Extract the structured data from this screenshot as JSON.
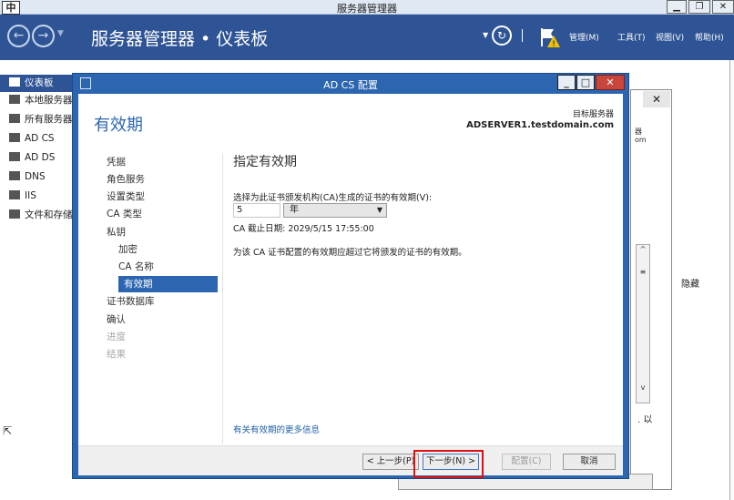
{
  "window": {
    "ime_indicator": "中",
    "title": "服务器管理器"
  },
  "header": {
    "breadcrumb": "服务器管理器 • 仪表板",
    "menus": [
      "管理(M)",
      "工具(T)",
      "视图(V)",
      "帮助(H)"
    ]
  },
  "sidebar": {
    "items": [
      {
        "label": "仪表板",
        "active": true
      },
      {
        "label": "本地服务器"
      },
      {
        "label": "所有服务器"
      },
      {
        "label": "AD CS"
      },
      {
        "label": "AD DS"
      },
      {
        "label": "DNS"
      },
      {
        "label": "IIS"
      },
      {
        "label": "文件和存储服务"
      }
    ]
  },
  "background": {
    "hide_label": "隐藏",
    "cut_text_1": "器",
    "cut_text_2": "om",
    "cut_text_3": ". 以"
  },
  "dialog": {
    "title": "AD CS 配置",
    "page_title": "有效期",
    "target_server_label": "目标服务器",
    "target_server": "ADSERVER1.testdomain.com",
    "nav": [
      {
        "label": "凭据",
        "level": 0,
        "state": "normal"
      },
      {
        "label": "角色服务",
        "level": 0,
        "state": "normal"
      },
      {
        "label": "设置类型",
        "level": 0,
        "state": "normal"
      },
      {
        "label": "CA 类型",
        "level": 0,
        "state": "normal"
      },
      {
        "label": "私钥",
        "level": 0,
        "state": "normal"
      },
      {
        "label": "加密",
        "level": 1,
        "state": "normal"
      },
      {
        "label": "CA 名称",
        "level": 1,
        "state": "normal"
      },
      {
        "label": "有效期",
        "level": 1,
        "state": "active"
      },
      {
        "label": "证书数据库",
        "level": 0,
        "state": "normal"
      },
      {
        "label": "确认",
        "level": 0,
        "state": "normal"
      },
      {
        "label": "进度",
        "level": 0,
        "state": "disabled"
      },
      {
        "label": "结果",
        "level": 0,
        "state": "disabled"
      }
    ],
    "section_title": "指定有效期",
    "validity_prompt": "选择为此证书颁发机构(CA)生成的证书的有效期(V):",
    "validity_value": "5",
    "validity_unit": "年",
    "expiry_text": "CA 截止日期: 2029/5/15 17:55:00",
    "notice_text": "为该 CA 证书配置的有效期应超过它将颁发的证书的有效期。",
    "more_info_link": "有关有效期的更多信息",
    "buttons": {
      "prev": "< 上一步(P)",
      "next": "下一步(N) >",
      "configure": "配置(C)",
      "cancel": "取消"
    }
  }
}
